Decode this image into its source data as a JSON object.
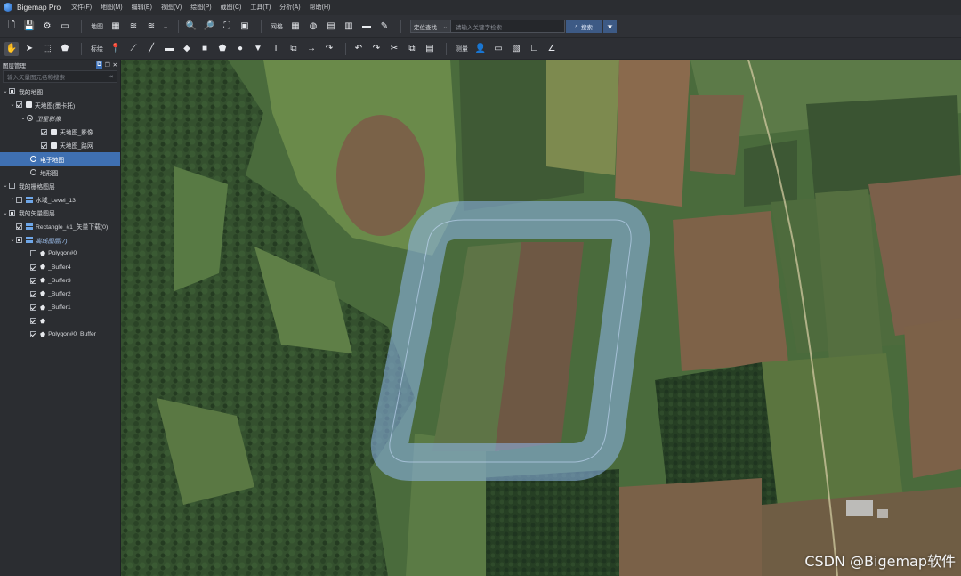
{
  "app": {
    "title": "Bigemap Pro"
  },
  "menu": [
    "文件(F)",
    "地图(M)",
    "编辑(E)",
    "视图(V)",
    "绘图(P)",
    "截图(C)",
    "工具(T)",
    "分析(A)",
    "帮助(H)"
  ],
  "toolbar1": {
    "map_label": "地图",
    "grid_label": "网格",
    "search_mode": "定位查找",
    "search_placeholder": "请输入关键字检索",
    "search_button": "搜索"
  },
  "toolbar2": {
    "mark_label": "标绘",
    "measure_label": "测量"
  },
  "panel": {
    "title": "图层管理",
    "search_placeholder": "输入矢量图元名称搜索",
    "tree": [
      {
        "label": "我的地图"
      },
      {
        "label": "天地图(墨卡托)"
      },
      {
        "label": "卫星影像"
      },
      {
        "label": "天地图_影像"
      },
      {
        "label": "天地图_路网"
      },
      {
        "label": "电子地图"
      },
      {
        "label": "地形图"
      },
      {
        "label": "我的栅格图层"
      },
      {
        "label": "水域_Level_13"
      },
      {
        "label": "我的矢量图层"
      },
      {
        "label": "Rectangle_#1_矢量下载(0)"
      },
      {
        "label": "离线图层(7)"
      },
      {
        "label": "Polygon#0"
      },
      {
        "label": "_Buffer4"
      },
      {
        "label": "_Buffer3"
      },
      {
        "label": "_Buffer2"
      },
      {
        "label": "_Buffer1"
      },
      {
        "label": ""
      },
      {
        "label": "Polygon#0_Buffer"
      }
    ]
  },
  "map": {
    "watermark": "CSDN @Bigemap软件",
    "buffer_color": "#8fb8ee"
  }
}
